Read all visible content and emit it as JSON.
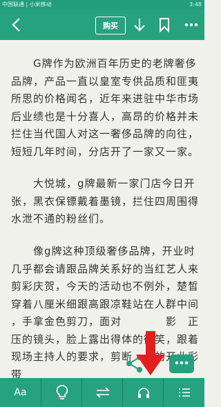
{
  "status": {
    "left_text": "中国联通 | 小米移动",
    "right_text": "3:48"
  },
  "toolbar": {
    "buy_label": "购买"
  },
  "paragraphs": [
    [
      "　　G牌作为欧洲百年历史的老牌奢侈",
      "品牌，产品一直以皇室专供品质和匪夷",
      "所思的价格闻名，近年来进驻中华市场",
      "后业绩也是十分喜人，高昂的价格并未",
      "拦住当代国人对这一奢侈品牌的向往，",
      "短短几年时间，分店开了一家又一家。"
    ],
    [
      "　　大悦城，g牌最新一家门店今日开",
      "张，黑衣保镖戴着墨镜，拦住四周围得",
      "水泄不通的粉丝们。"
    ],
    [
      "　　像g牌这种顶级奢侈品牌，开业时",
      "几乎都会请跟品牌关系好的当红艺人来",
      "剪彩庆贺，今天的活动也不例外，楚皙",
      "穿着八厘米细跟高跟凉鞋站在人群中间",
      "，手拿金色剪刀，面对　　　　影　正",
      "压的镜头，脸上露出得体的微笑，跟着",
      "现场主持人的要求，剪断　　的开业彩",
      "带"
    ]
  ],
  "bottom": {
    "font_label": "Aa"
  },
  "colors": {
    "accent": "#26a27f",
    "background": "#f1f1ec",
    "arrow": "#e02020"
  }
}
